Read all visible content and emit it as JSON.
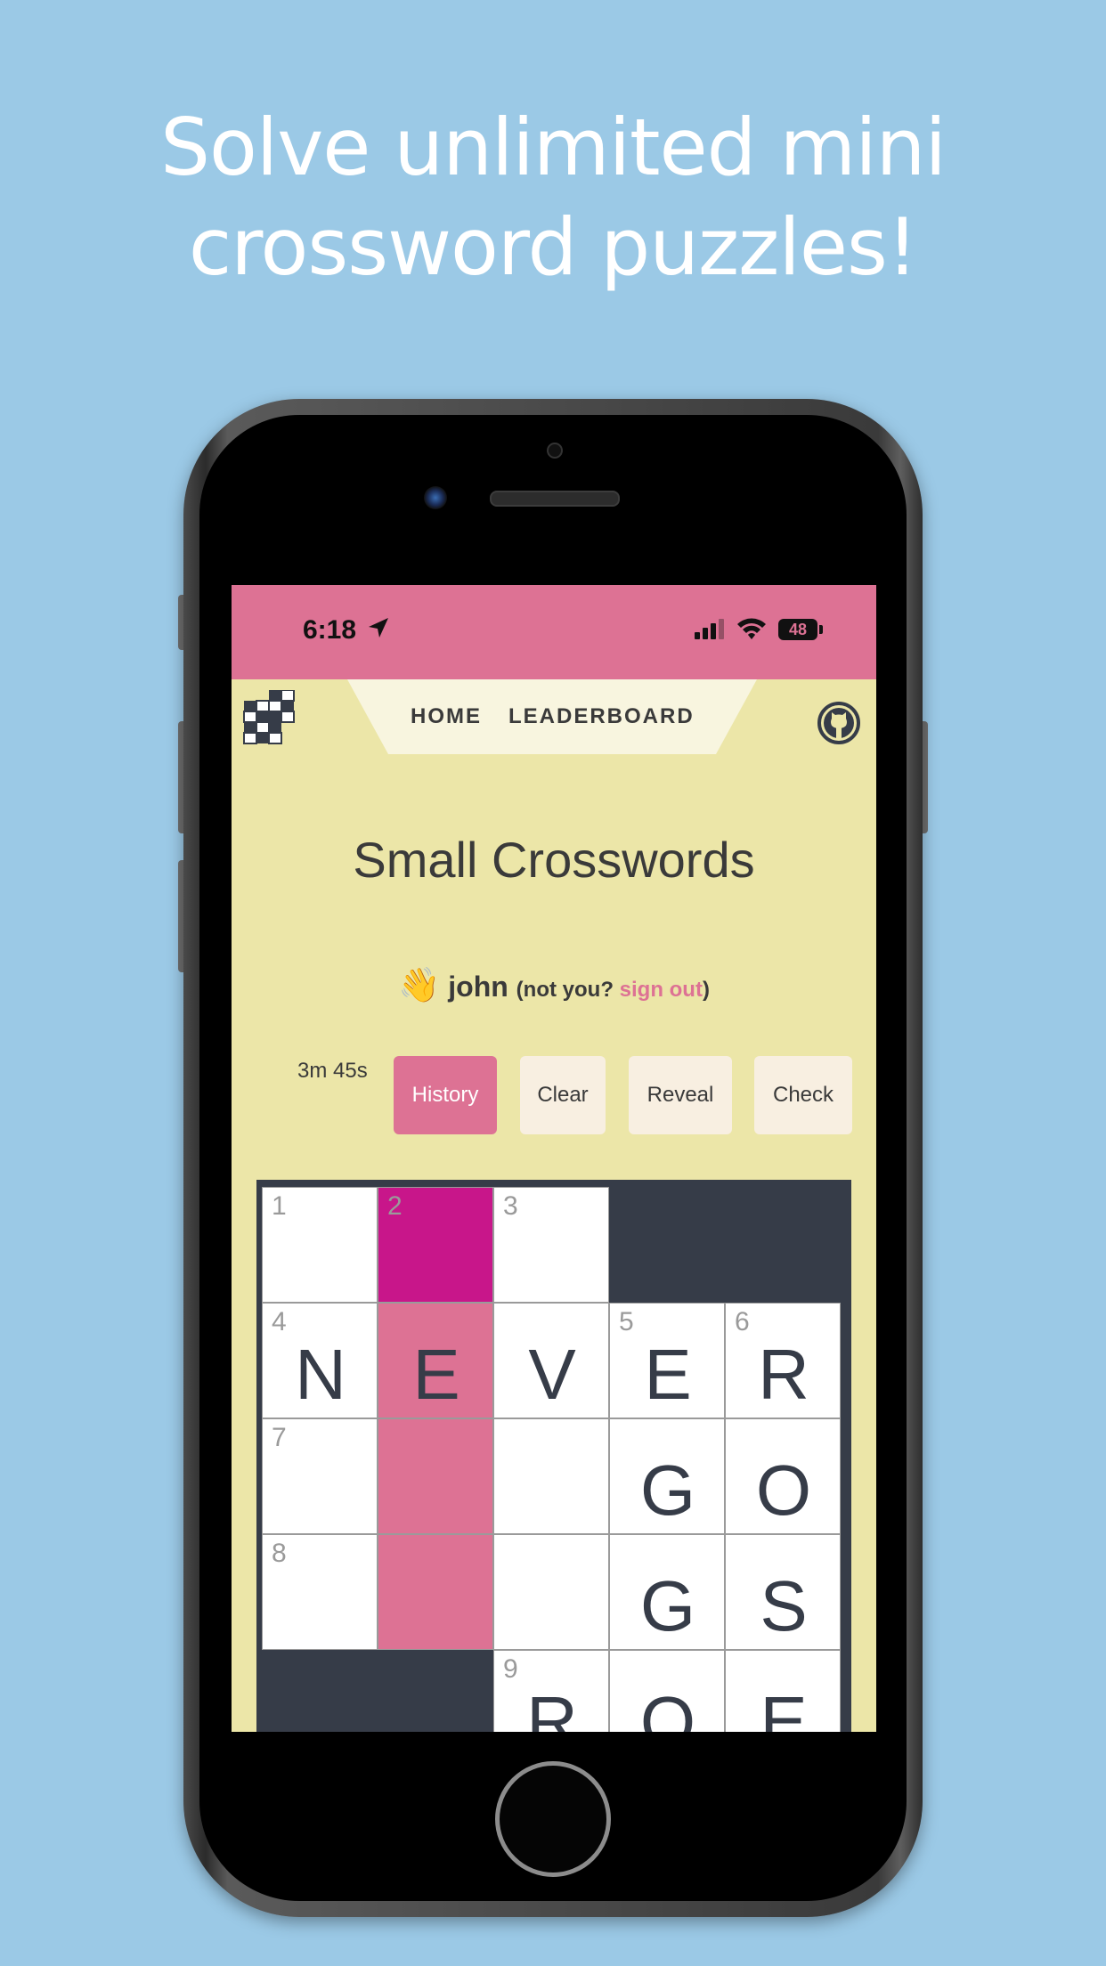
{
  "promo": {
    "line1": "Solve unlimited mini",
    "line2": "crossword puzzles!"
  },
  "status_bar": {
    "time": "6:18",
    "battery": "48",
    "icons": [
      "location-arrow-icon",
      "signal-icon",
      "wifi-icon",
      "battery-icon"
    ]
  },
  "nav": {
    "home": "HOME",
    "leaderboard": "LEADERBOARD",
    "logo": "crossword-logo-icon",
    "github": "github-icon"
  },
  "title": "Small Crosswords",
  "greeting": {
    "emoji": "👋",
    "name": "john",
    "prefix": "(not you? ",
    "sign_out": "sign out",
    "suffix": ")"
  },
  "controls": {
    "timer": "3m 45s",
    "history": "History",
    "clear": "Clear",
    "reveal": "Reveal",
    "check": "Check"
  },
  "colors": {
    "background": "#9bc9e6",
    "accent_pink": "#dd7294",
    "active_cell": "#c8168a",
    "page_bg": "#ece6a8",
    "block": "#363c48"
  },
  "grid": {
    "rows": [
      [
        {
          "num": "1",
          "letter": ""
        },
        {
          "num": "2",
          "letter": "",
          "state": "active"
        },
        {
          "num": "3",
          "letter": ""
        },
        {
          "block": true
        },
        {
          "block": true
        }
      ],
      [
        {
          "num": "4",
          "letter": "N"
        },
        {
          "num": "",
          "letter": "E",
          "state": "hl"
        },
        {
          "num": "",
          "letter": "V"
        },
        {
          "num": "5",
          "letter": "E"
        },
        {
          "num": "6",
          "letter": "R"
        }
      ],
      [
        {
          "num": "7",
          "letter": ""
        },
        {
          "num": "",
          "letter": "",
          "state": "hl"
        },
        {
          "num": "",
          "letter": ""
        },
        {
          "num": "",
          "letter": "G"
        },
        {
          "num": "",
          "letter": "O"
        }
      ],
      [
        {
          "num": "8",
          "letter": ""
        },
        {
          "num": "",
          "letter": "",
          "state": "hl"
        },
        {
          "num": "",
          "letter": ""
        },
        {
          "num": "",
          "letter": "G"
        },
        {
          "num": "",
          "letter": "S"
        }
      ],
      [
        {
          "block": true
        },
        {
          "block": true
        },
        {
          "num": "9",
          "letter": "R"
        },
        {
          "num": "",
          "letter": "O"
        },
        {
          "num": "",
          "letter": "E"
        }
      ]
    ]
  }
}
